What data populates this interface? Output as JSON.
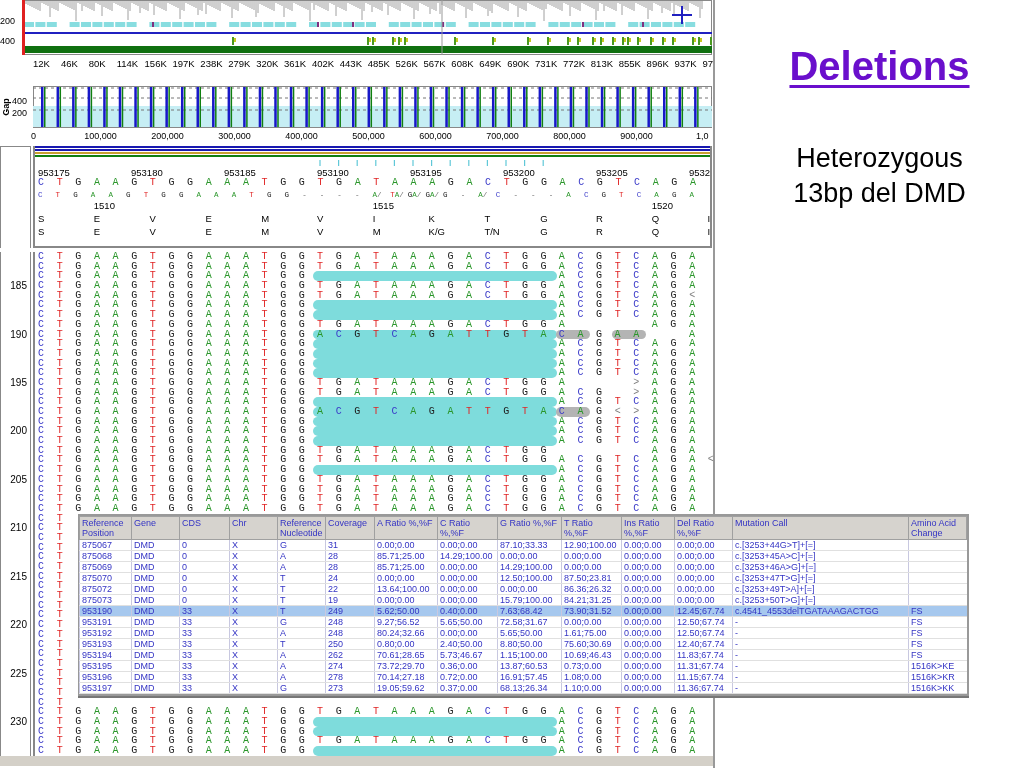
{
  "overview": {
    "y_labels": [
      "200",
      "400"
    ],
    "x_labels": [
      "12K",
      "46K",
      "80K",
      "114K",
      "156K",
      "197K",
      "238K",
      "279K",
      "320K",
      "361K",
      "402K",
      "443K",
      "485K",
      "526K",
      "567K",
      "608K",
      "649K",
      "690K",
      "731K",
      "772K",
      "813K",
      "855K",
      "896K",
      "937K",
      "97"
    ]
  },
  "gap_chart": {
    "label": "Gap",
    "y_labels": [
      "400",
      "200"
    ],
    "x_labels": [
      "0",
      "100,000",
      "200,000",
      "300,000",
      "400,000",
      "500,000",
      "600,000",
      "700,000",
      "800,000",
      "900,000",
      "1,0"
    ]
  },
  "reference": {
    "positions": [
      "953175",
      "953180",
      "953185",
      "953190",
      "953195",
      "953200",
      "953205",
      "9532"
    ],
    "sequence": "C T G A A G T G G A A A T G G T G A T A A A G A C T G G A C G T C A G A",
    "consensus": "C T G A A G T G G A A A T G G - - - - A/ TA/ GA/ GA/ G - A/ C - - - A C G T C A G A",
    "codon_numbers": [
      "1510",
      "1515",
      "1520"
    ],
    "translation_1": "S E V E M V I K T G R Q I",
    "translation_2": "S E V E M V M K/G T/N G R Q I"
  },
  "reads": [
    {
      "left": "C T G A A G T G G A A A T G G",
      "middle": "T G A T A A A G A C T G G",
      "deletion": false,
      "right": "A C G T C A G A"
    },
    {
      "left": "C T G A A G T G G A A A T G G",
      "middle": "T G A T A A A G A C T G G",
      "deletion": false,
      "right": "A C G T C A G A"
    },
    {
      "left": "C T G A A G T G G A A A T G G",
      "deletion": true,
      "right": "A C G T C A G A"
    },
    {
      "number": "185",
      "left": "C T G A A G T G G A A A T G G",
      "middle": "T G A T A A A G A C T G G",
      "deletion": false,
      "right": "A C G T C A G A"
    },
    {
      "left": "C T G A A G T G G A A A T G G",
      "middle": "T G A T A A A G A C T G G",
      "deletion": false,
      "right": "A C G T C A G <"
    },
    {
      "left": "C T G A A G T G G A A A T G G",
      "deletion": true,
      "right": "A C G T C A G A"
    },
    {
      "left": "C T G A A G T G G A A A T G G",
      "deletion": true,
      "right": "A C G T C A G A"
    },
    {
      "left": "C T G A A G T G G A A A T G G",
      "middle": "T G A T A A A G A C T G G",
      "deletion": false,
      "right_cells": [
        "A",
        null,
        null,
        null,
        null,
        "A",
        "G",
        "A"
      ]
    },
    {
      "number": "190",
      "left": "C T G A A G T G G A A A T G G",
      "middle": "A C G T C A G A T T G T A",
      "deletion": true,
      "right_cells": [
        "C",
        "A",
        "G",
        "A",
        "A",
        null,
        null,
        "A"
      ],
      "soft_clip": true,
      "soft_clip_2": true
    },
    {
      "left": "C T G A A G T G G A A A T G G",
      "deletion": true,
      "right": "A C G T C A G A"
    },
    {
      "left": "C T G A A G T G G A A A T G G",
      "deletion": true,
      "right": "A C G T C A G A"
    },
    {
      "left": "C T G A A G T G G A A A T G G",
      "deletion": true,
      "right": "A C G T C A G A"
    },
    {
      "left": "C T G A A G T G G A A A T G G",
      "deletion": true,
      "right": "A C G T C A G A"
    },
    {
      "number": "195",
      "left": "C T G A A G T G G A A A T G G",
      "middle": "T G A T A A A G A C T G G",
      "deletion": false,
      "right_cells": [
        "A",
        null,
        null,
        null,
        ">",
        "A",
        "G",
        "A"
      ]
    },
    {
      "left": "C T G A A G T G G A A A T G G",
      "middle": "T G A T A A A G A C T G G",
      "deletion": false,
      "right_cells": [
        "A",
        "C",
        "G",
        null,
        ">",
        "A",
        "G",
        "A"
      ]
    },
    {
      "left": "C T G A A G T G G A A A T G G",
      "deletion": true,
      "right": "A C G T C A G A"
    },
    {
      "left": "C T G A A G T G G A A A T G G",
      "middle": "A C G T C A G A T T G T A",
      "deletion": true,
      "right": "C A G < > A G A",
      "soft_clip": true,
      "soft_clip_2": false
    },
    {
      "left": "C T G A A G T G G A A A T G G",
      "deletion": true,
      "right": "A C G T C A G A"
    },
    {
      "number": "200",
      "left": "C T G A A G T G G A A A T G G",
      "deletion": true,
      "right": "A C G T C A G A"
    },
    {
      "left": "C T G A A G T G G A A A T G G",
      "deletion": true,
      "right": "A C G T C A G A"
    },
    {
      "left": "C T G A A G T G G A A A T G G",
      "middle": "T G A T A A A G A C T G G",
      "deletion": false,
      "right_cells": [
        null,
        null,
        null,
        null,
        null,
        "A",
        "G",
        "A"
      ]
    },
    {
      "left": "C T G A A G T G G A A A T G G",
      "middle": "T G A T A A A G A C T G G",
      "deletion": false,
      "right": "A C G T C A G A <"
    },
    {
      "left": "C T G A A G T G G A A A T G G",
      "deletion": true,
      "right": "A C G T C A G A"
    },
    {
      "number": "205",
      "left": "C T G A A G T G G A A A T G G",
      "middle": "T G A T A A A G A C T G G",
      "deletion": false,
      "right": "A C G T C A G A"
    },
    {
      "left": "C T G A A G T G G A A A T G G",
      "middle": "T G A T A A A G A C T G G",
      "deletion": false,
      "right": "A C G T C A G A"
    },
    {
      "left": "C T G A A G T G G A A A T G G",
      "middle": "T G A T A A A G A C T G G",
      "deletion": false,
      "right": "A C G T C A G A"
    },
    {
      "left": "C T G A A G T G G A A A T G G",
      "middle": "T G A T A A A G A C T G G",
      "deletion": false,
      "right": "A C G T C A G A"
    },
    {
      "left": "C T",
      "deletion": false
    },
    {
      "number": "210",
      "left": "C T",
      "deletion": false
    },
    {
      "left": "C T",
      "deletion": false
    },
    {
      "left": "C T",
      "deletion": false
    },
    {
      "left": "C T",
      "deletion": false
    },
    {
      "left": "C T",
      "deletion": false
    },
    {
      "number": "215",
      "left": "C T",
      "deletion": false
    },
    {
      "left": "C T",
      "deletion": false
    },
    {
      "left": "C T",
      "deletion": false
    },
    {
      "left": "C T",
      "deletion": false
    },
    {
      "left": "C T",
      "deletion": false
    },
    {
      "number": "220",
      "left": "C T",
      "deletion": false
    },
    {
      "left": "C T",
      "deletion": false
    },
    {
      "left": "C T",
      "deletion": false
    },
    {
      "left": "C T",
      "deletion": false
    },
    {
      "left": "C T",
      "deletion": false
    },
    {
      "number": "225",
      "left": "C T",
      "deletion": false
    },
    {
      "left": "C T",
      "deletion": false
    },
    {
      "left": "C T",
      "deletion": false
    },
    {
      "left": "C T",
      "deletion": false
    },
    {
      "left": "C T G A A G T G G A A A T G G",
      "middle": "T G A T A A A G A C T G G",
      "deletion": false,
      "right": "A C G T C A G A"
    },
    {
      "number": "230",
      "left": "C T G A A G T G G A A A T G G",
      "deletion": true,
      "right": "A C G T C A G A"
    },
    {
      "left": "C T G A A G T G G A A A T G G",
      "deletion": true,
      "right": "A C G T C A G A"
    },
    {
      "left": "C T G A A G T G G A A A T G G",
      "middle": "T G A T A A A G A C T G G",
      "deletion": false,
      "right": "A C G T C A G A"
    },
    {
      "left": "C T G A A G T G G A A A T G G",
      "deletion": true,
      "right": "A C G T C A G A"
    }
  ],
  "variant_table": {
    "columns": [
      "Reference Position",
      "Gene",
      "CDS",
      "Chr",
      "Reference Nucleotide",
      "Coverage",
      "A Ratio %,%F",
      "C Ratio %,%F",
      "G Ratio %,%F",
      "T Ratio %,%F",
      "Ins Ratio %,%F",
      "Del Ratio %,%F",
      "Mutation Call",
      "Amino Acid Change"
    ],
    "rows": [
      {
        "selected": false,
        "cells": [
          "875067",
          "DMD",
          "0",
          "X",
          "G",
          "31",
          "0.00;0.00",
          "0.00;0.00",
          "87.10;33.33",
          "12.90;100.00",
          "0.00;0.00",
          "0.00;0.00",
          "c.[3253+44G>T]+[=]"
        ]
      },
      {
        "selected": false,
        "cells": [
          "875068",
          "DMD",
          "0",
          "X",
          "A",
          "28",
          "85.71;25.00",
          "14.29;100.00",
          "0.00;0.00",
          "0.00;0.00",
          "0.00;0.00",
          "0.00;0.00",
          "c.[3253+45A>C]+[=]"
        ]
      },
      {
        "selected": false,
        "cells": [
          "875069",
          "DMD",
          "0",
          "X",
          "A",
          "28",
          "85.71;25.00",
          "0.00;0.00",
          "14.29;100.00",
          "0.00;0.00",
          "0.00;0.00",
          "0.00;0.00",
          "c.[3253+46A>G]+[=]"
        ]
      },
      {
        "selected": false,
        "cells": [
          "875070",
          "DMD",
          "0",
          "X",
          "T",
          "24",
          "0.00;0.00",
          "0.00;0.00",
          "12.50;100.00",
          "87.50;23.81",
          "0.00;0.00",
          "0.00;0.00",
          "c.[3253+47T>G]+[=]"
        ]
      },
      {
        "selected": false,
        "cells": [
          "875072",
          "DMD",
          "0",
          "X",
          "T",
          "22",
          "13.64;100.00",
          "0.00;0.00",
          "0.00;0.00",
          "86.36;26.32",
          "0.00;0.00",
          "0.00;0.00",
          "c.[3253+49T>A]+[=]"
        ]
      },
      {
        "selected": false,
        "cells": [
          "875073",
          "DMD",
          "0",
          "X",
          "T",
          "19",
          "0.00;0.00",
          "0.00;0.00",
          "15.79;100.00",
          "84.21;31.25",
          "0.00;0.00",
          "0.00;0.00",
          "c.[3253+50T>G]+[=]"
        ]
      },
      {
        "selected": true,
        "cells": [
          "953190",
          "DMD",
          "33",
          "X",
          "T",
          "249",
          "5.62;50.00",
          "0.40;0.00",
          "7.63;68.42",
          "73.90;31.52",
          "0.00;0.00",
          "12.45;67.74",
          "c.4541_4553delTGATAAAGACTGG",
          "FS"
        ]
      },
      {
        "selected": false,
        "cells": [
          "953191",
          "DMD",
          "33",
          "X",
          "G",
          "248",
          "9.27;56.52",
          "5.65;50.00",
          "72.58;31.67",
          "0.00;0.00",
          "0.00;0.00",
          "12.50;67.74",
          "-",
          "FS"
        ]
      },
      {
        "selected": false,
        "cells": [
          "953192",
          "DMD",
          "33",
          "X",
          "A",
          "248",
          "80.24;32.66",
          "0.00;0.00",
          "5.65;50.00",
          "1.61;75.00",
          "0.00;0.00",
          "12.50;67.74",
          "-",
          "FS"
        ]
      },
      {
        "selected": false,
        "cells": [
          "953193",
          "DMD",
          "33",
          "X",
          "T",
          "250",
          "0.80;0.00",
          "2.40;50.00",
          "8.80;50.00",
          "75.60;30.69",
          "0.00;0.00",
          "12.40;67.74",
          "-",
          "FS"
        ]
      },
      {
        "selected": false,
        "cells": [
          "953194",
          "DMD",
          "33",
          "X",
          "A",
          "262",
          "70.61;28.65",
          "5.73;46.67",
          "1.15;100.00",
          "10.69;46.43",
          "0.00;0.00",
          "11.83;67.74",
          "-",
          "FS"
        ]
      },
      {
        "selected": false,
        "cells": [
          "953195",
          "DMD",
          "33",
          "X",
          "A",
          "274",
          "73.72;29.70",
          "0.36;0.00",
          "13.87;60.53",
          "0.73;0.00",
          "0.00;0.00",
          "11.31;67.74",
          "-",
          "1516K>KE"
        ]
      },
      {
        "selected": false,
        "cells": [
          "953196",
          "DMD",
          "33",
          "X",
          "A",
          "278",
          "70.14;27.18",
          "0.72;0.00",
          "16.91;57.45",
          "1.08;0.00",
          "0.00;0.00",
          "11.15;67.74",
          "-",
          "1516K>KR"
        ]
      },
      {
        "selected": false,
        "cells": [
          "953197",
          "DMD",
          "33",
          "X",
          "G",
          "273",
          "19.05;59.62",
          "0.37;0.00",
          "68.13;26.34",
          "1.10;0.00",
          "0.00;0.00",
          "11.36;67.74",
          "-",
          "1516K>KK"
        ]
      }
    ]
  },
  "slide": {
    "title": "Deletions",
    "subtitle_lines": [
      "Heterozygous",
      "13bp del DMD"
    ]
  }
}
